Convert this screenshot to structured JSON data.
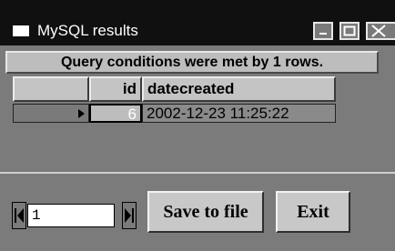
{
  "window": {
    "title": "MySQL results",
    "controls": {
      "minimize_icon": "minimize-icon",
      "maximize_icon": "maximize-icon",
      "close_icon": "close-icon"
    }
  },
  "banner": {
    "text": "Query conditions were met by 1 rows."
  },
  "grid": {
    "columns": [
      "id",
      "datecreated"
    ],
    "rows": [
      {
        "id": "6",
        "datecreated": "2002-12-23 11:25:22",
        "current": true
      }
    ]
  },
  "navigator": {
    "first_icon": "first-record-icon",
    "last_icon": "last-record-icon",
    "page_value": "1"
  },
  "buttons": {
    "save_label": "Save to file",
    "exit_label": "Exit"
  },
  "colors": {
    "title_bar": "#101010",
    "window_bg": "#7b7b7b",
    "button_face": "#c8c8c8"
  }
}
